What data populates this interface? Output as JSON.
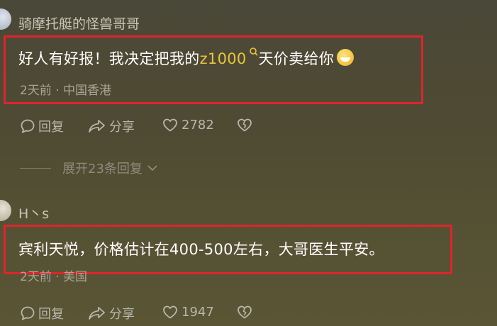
{
  "comments": [
    {
      "username": "骑摩托艇的怪兽哥哥",
      "text_before": "好人有好报！我决定把我的",
      "text_highlight": "z1000",
      "text_after": "天价卖给你",
      "time": "2天前",
      "location": "中国香港",
      "reply_label": "回复",
      "share_label": "分享",
      "like_count": "2782",
      "expand_label": "展开23条回复"
    },
    {
      "username": "H丶s",
      "text": "宾利天悦，价格估计在400-500左右，大哥医生平安。",
      "time": "2天前",
      "location": "美国",
      "reply_label": "回复",
      "share_label": "分享",
      "like_count": "1947"
    }
  ],
  "meta_separator": "·",
  "colors": {
    "highlight": "#e9c43a",
    "annotation_box": "#e0242c"
  }
}
